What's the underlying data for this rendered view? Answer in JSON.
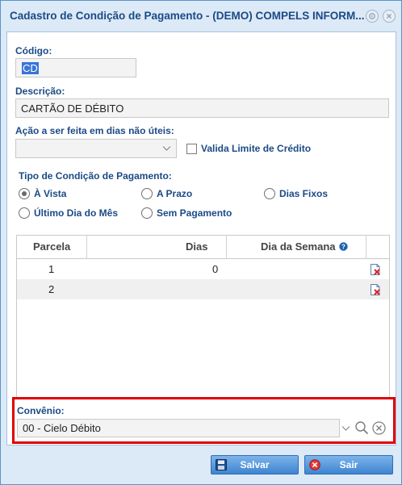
{
  "window": {
    "title": "Cadastro de Condição de Pagamento - (DEMO) COMPELS INFORM..."
  },
  "form": {
    "codigo_label": "Código:",
    "codigo_value": "CD",
    "descricao_label": "Descrição:",
    "descricao_value": "CARTÃO DE DÉBITO",
    "acao_label": "Ação a ser feita em dias não úteis:",
    "acao_value": "",
    "valida_limite_label": "Valida Limite de Crédito",
    "valida_limite_checked": false,
    "tipo_label": "Tipo de Condição de Pagamento:",
    "tipo_options": [
      {
        "label": "À Vista",
        "checked": true
      },
      {
        "label": "A Prazo",
        "checked": false
      },
      {
        "label": "Dias Fixos",
        "checked": false
      },
      {
        "label": "Último Dia do Mês",
        "checked": false
      },
      {
        "label": "Sem Pagamento",
        "checked": false
      }
    ]
  },
  "grid": {
    "columns": [
      "Parcela",
      "Dias",
      "Dia da Semana"
    ],
    "help_icon": "help-icon",
    "rows": [
      {
        "parcela": "1",
        "dias": "0",
        "dia_semana": ""
      },
      {
        "parcela": "2",
        "dias": "",
        "dia_semana": ""
      }
    ]
  },
  "convenio": {
    "label": "Convênio:",
    "value": "00 - Cielo Débito"
  },
  "buttons": {
    "save_label": "Salvar",
    "exit_label": "Sair"
  },
  "colors": {
    "title": "#1b4a86",
    "highlight_border": "#e00000",
    "button": "#3e84d0"
  }
}
